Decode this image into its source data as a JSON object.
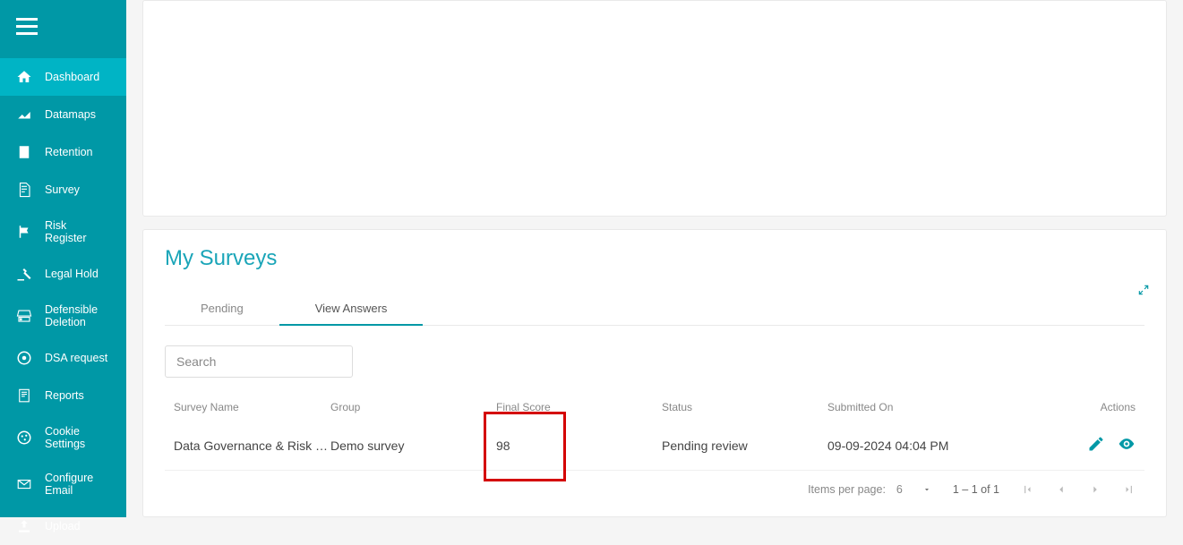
{
  "sidebar": {
    "items": [
      {
        "label": "Dashboard",
        "icon": "home-icon",
        "active": true
      },
      {
        "label": "Datamaps",
        "icon": "chart-icon",
        "active": false
      },
      {
        "label": "Retention",
        "icon": "building-icon",
        "active": false
      },
      {
        "label": "Survey",
        "icon": "document-icon",
        "active": false
      },
      {
        "label": "Risk Register",
        "icon": "flag-icon",
        "active": false
      },
      {
        "label": "Legal Hold",
        "icon": "gavel-icon",
        "active": false
      },
      {
        "label": "Defensible Deletion",
        "icon": "drive-icon",
        "active": false
      },
      {
        "label": "DSA request",
        "icon": "target-icon",
        "active": false
      },
      {
        "label": "Reports",
        "icon": "report-icon",
        "active": false
      },
      {
        "label": "Cookie Settings",
        "icon": "cookie-icon",
        "active": false
      },
      {
        "label": "Configure Email",
        "icon": "email-icon",
        "active": false
      },
      {
        "label": "Upload",
        "icon": "upload-icon",
        "active": false
      }
    ]
  },
  "surveys": {
    "title": "My Surveys",
    "tabs": [
      {
        "label": "Pending",
        "active": false
      },
      {
        "label": "View Answers",
        "active": true
      }
    ],
    "search_placeholder": "Search",
    "columns": {
      "survey_name": "Survey Name",
      "group": "Group",
      "final_score": "Final Score",
      "status": "Status",
      "submitted_on": "Submitted On",
      "actions": "Actions"
    },
    "rows": [
      {
        "survey_name": "Data Governance & Risk Mana...",
        "group": "Demo survey",
        "final_score": "98",
        "status": "Pending review",
        "submitted_on": "09-09-2024 04:04 PM"
      }
    ],
    "pagination": {
      "items_per_page_label": "Items per page:",
      "items_per_page_value": "6",
      "range": "1 – 1 of 1"
    }
  },
  "colors": {
    "primary": "#0098a6",
    "highlight": "#d40000"
  }
}
